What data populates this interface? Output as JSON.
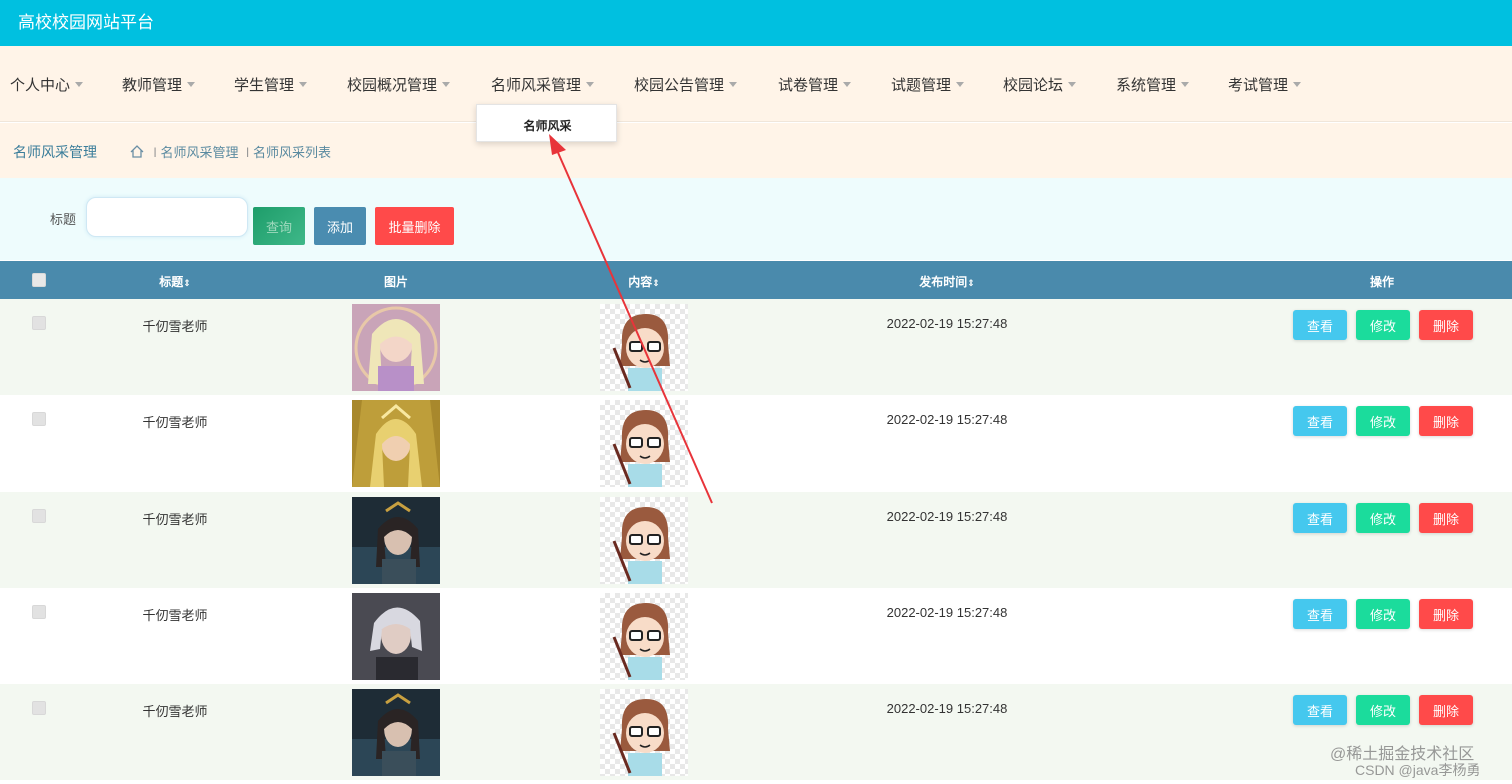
{
  "app": {
    "title": "高校校园网站平台"
  },
  "nav": {
    "items": [
      {
        "label": "个人中心"
      },
      {
        "label": "教师管理"
      },
      {
        "label": "学生管理"
      },
      {
        "label": "校园概况管理"
      },
      {
        "label": "名师风采管理"
      },
      {
        "label": "校园公告管理"
      },
      {
        "label": "试卷管理"
      },
      {
        "label": "试题管理"
      },
      {
        "label": "校园论坛"
      },
      {
        "label": "系统管理"
      },
      {
        "label": "考试管理"
      }
    ],
    "dropdown": {
      "item": "名师风采"
    }
  },
  "breadcrumb": {
    "title": "名师风采管理",
    "items": [
      "名师风采管理",
      "名师风采列表"
    ],
    "separator": "l"
  },
  "search": {
    "label": "标题",
    "value": "",
    "search_button": "查询",
    "add_button": "添加",
    "batch_delete_button": "批量删除"
  },
  "table": {
    "headers": {
      "title": "标题",
      "image": "图片",
      "content": "内容",
      "publish_time": "发布时间",
      "actions": "操作"
    },
    "sort_glyph": "⇕",
    "rows": [
      {
        "title": "千仞雪老师",
        "time": "2022-02-19 15:27:48"
      },
      {
        "title": "千仞雪老师",
        "time": "2022-02-19 15:27:48"
      },
      {
        "title": "千仞雪老师",
        "time": "2022-02-19 15:27:48"
      },
      {
        "title": "千仞雪老师",
        "time": "2022-02-19 15:27:48"
      },
      {
        "title": "千仞雪老师",
        "time": "2022-02-19 15:27:48"
      }
    ],
    "row_actions": {
      "view": "查看",
      "edit": "修改",
      "delete": "删除"
    }
  },
  "watermark": {
    "line1": "@稀土掘金技术社区",
    "line2": "CSDN @java李杨勇"
  },
  "colors": {
    "header": "#00c0e0",
    "table_head": "#4a8aac",
    "danger": "#ff4a4a",
    "success": "#1bdc9c",
    "info": "#45c8ee"
  }
}
